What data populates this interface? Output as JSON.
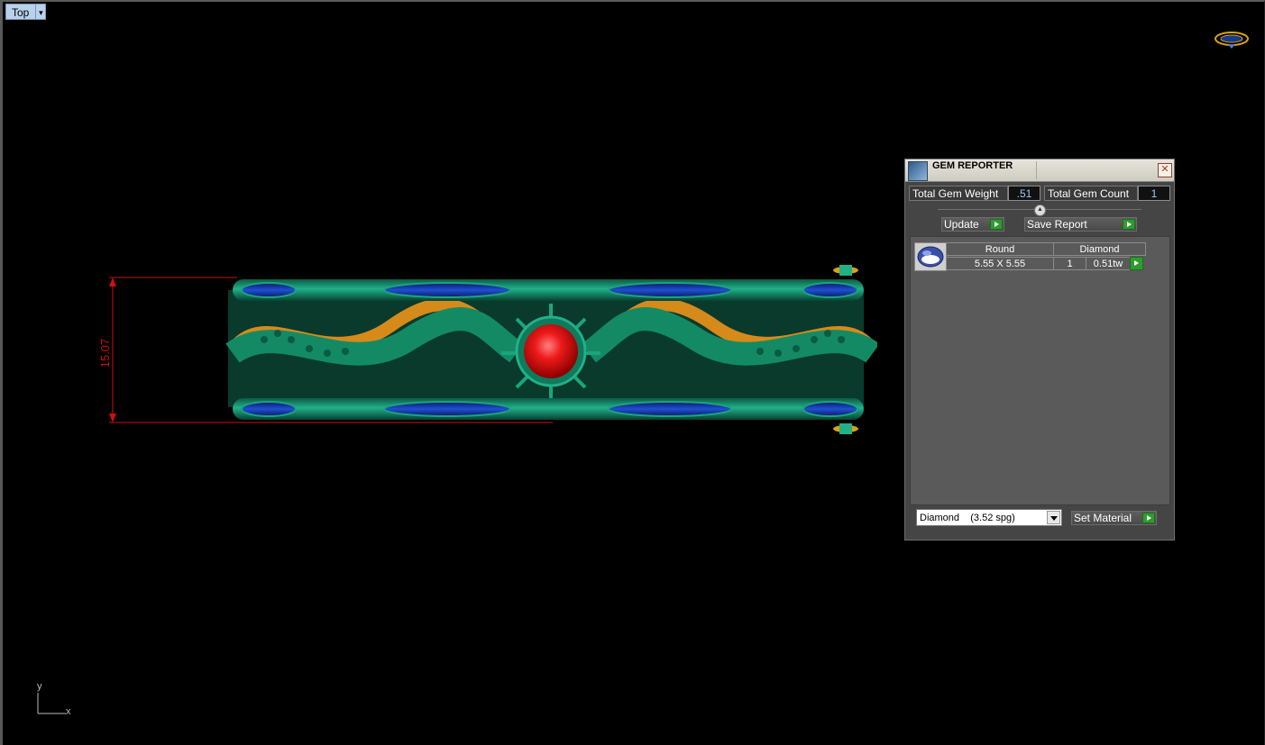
{
  "viewport": {
    "view_name": "Top",
    "axis_x": "x",
    "axis_y": "y",
    "dimension_value": "15.07"
  },
  "gem_reporter": {
    "title": "GEM REPORTER",
    "total_weight_label": "Total Gem Weight",
    "total_weight_value": ".51",
    "total_count_label": "Total Gem Count",
    "total_count_value": "1",
    "update_label": "Update",
    "save_report_label": "Save Report",
    "columns": [
      "Round",
      "Diamond"
    ],
    "row": {
      "size": "5.55 X 5.55",
      "count": "1",
      "weight": "0.51tw"
    },
    "material_selected": "Diamond    (3.52 spg)",
    "set_material_label": "Set Material"
  },
  "colors": {
    "metal": "#0f7a5c",
    "gem": "#e01020",
    "inlay": "#1030a0",
    "gold": "#d68a1a",
    "dimension": "#cc1010"
  }
}
